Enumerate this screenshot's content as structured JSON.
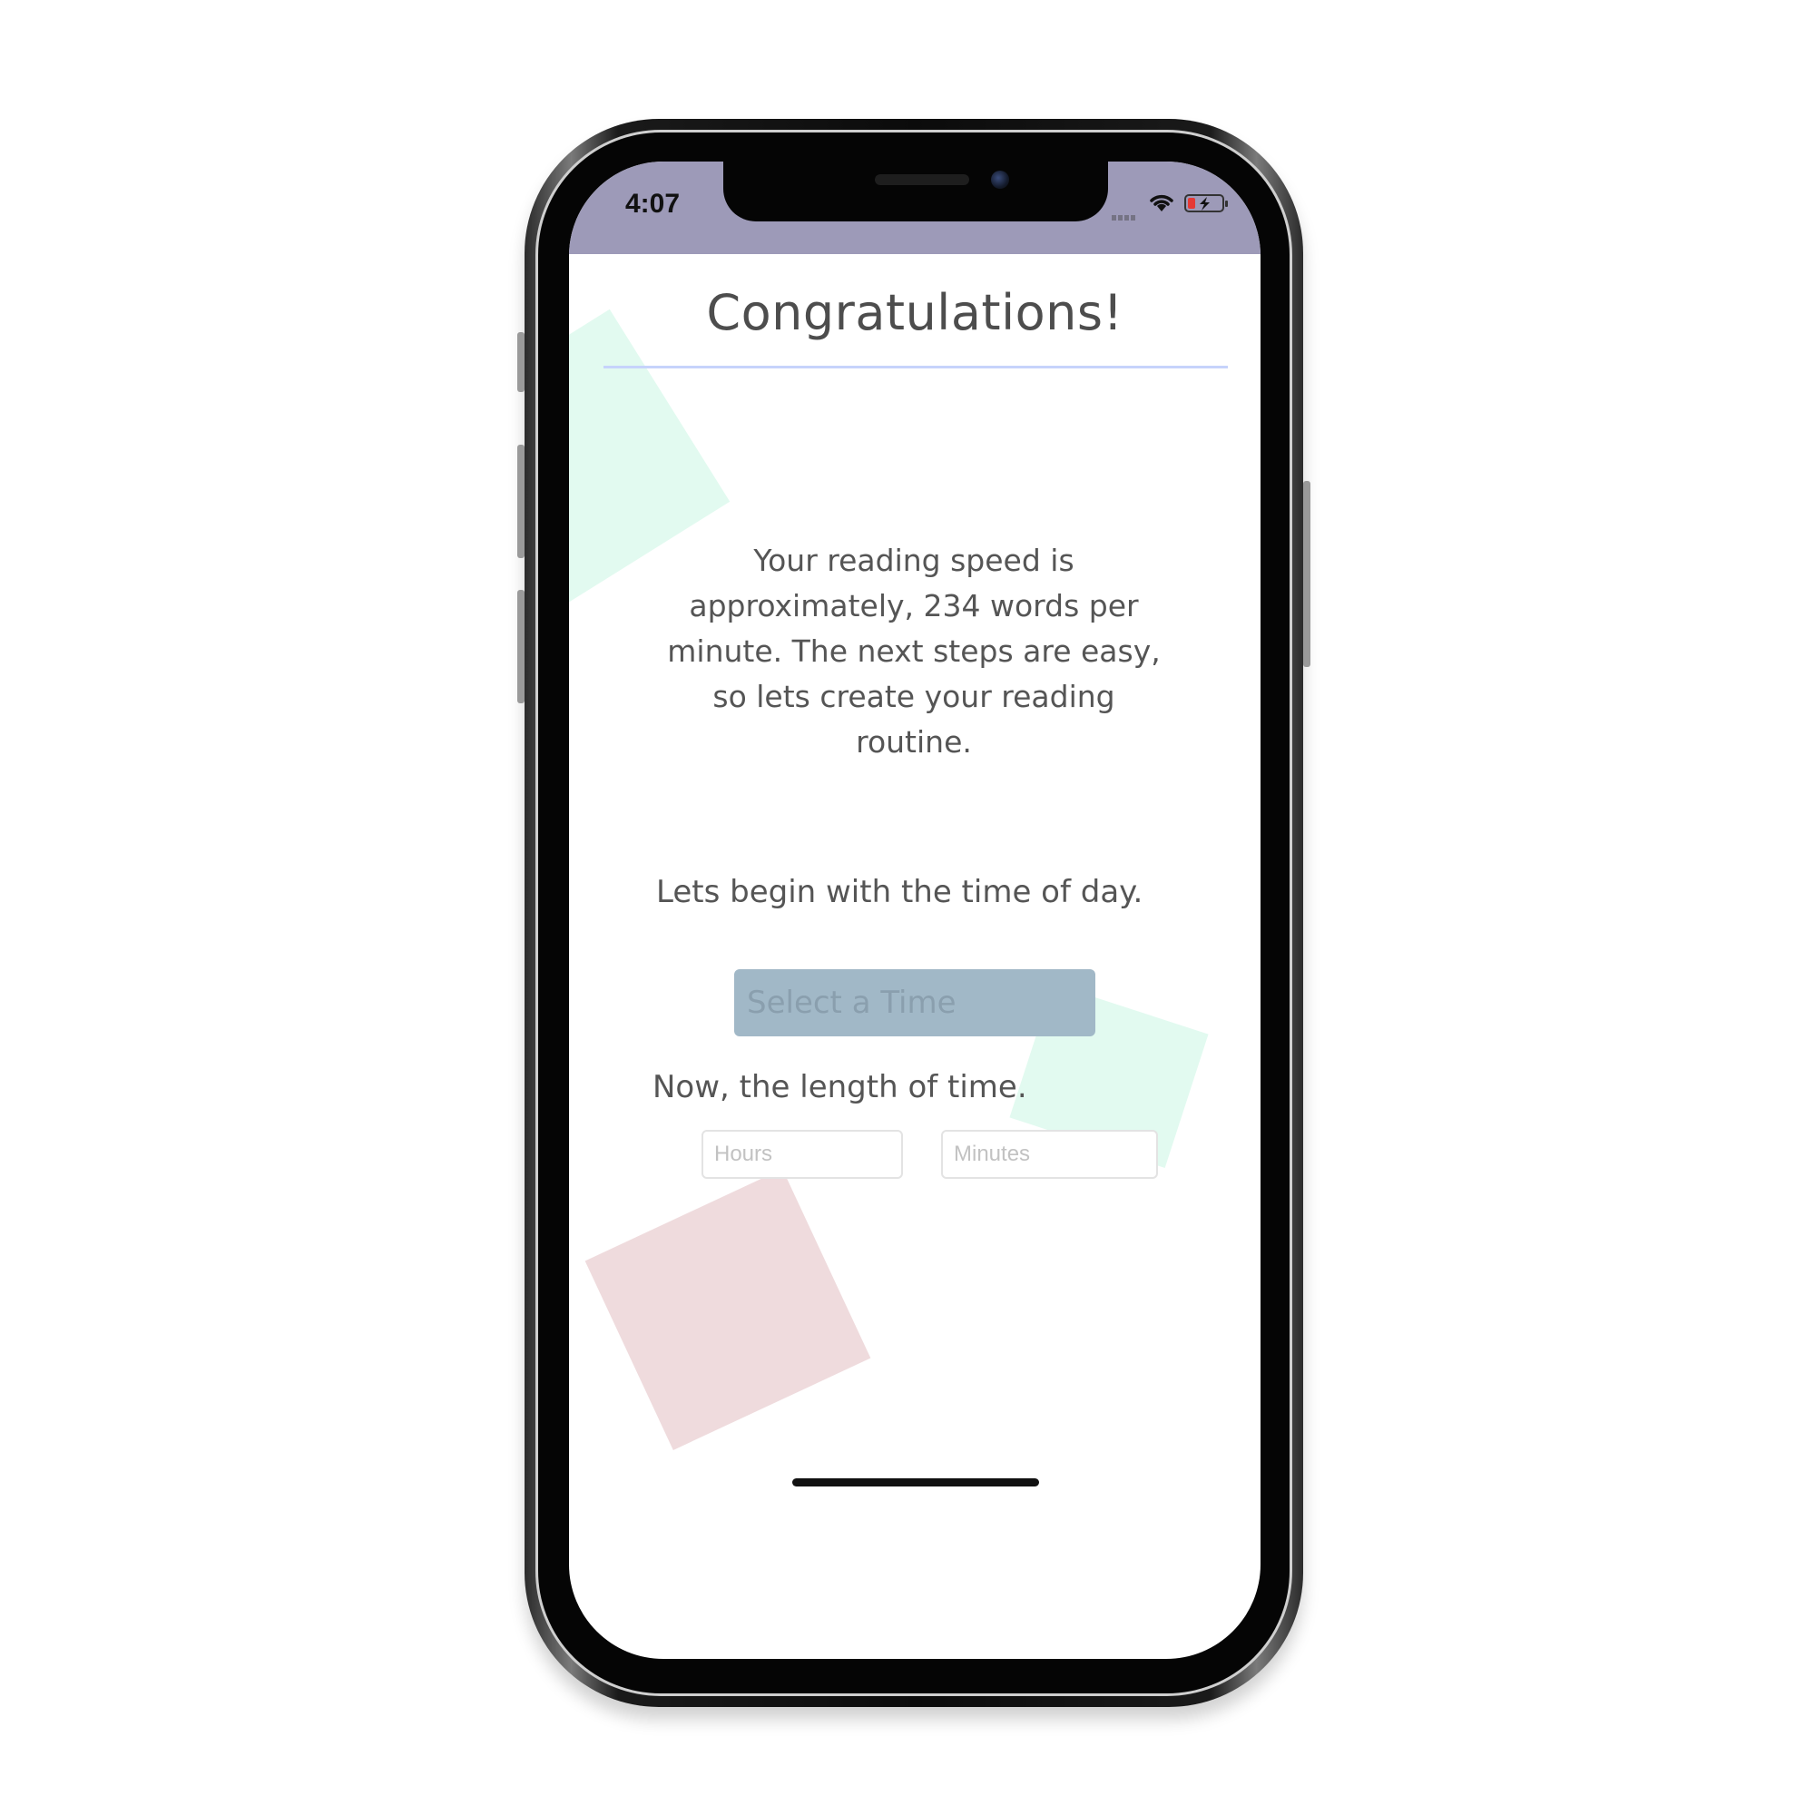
{
  "status_bar": {
    "time": "4:07",
    "background_color": "#9d9ab8",
    "icons": [
      "signal-icon",
      "wifi-icon",
      "battery-icon"
    ]
  },
  "header": {
    "title": "Congratulations!",
    "divider_color": "#c6d3fb"
  },
  "main": {
    "message": "Your reading speed is approximately, 234 words per minute. The next steps are easy, so lets create your reading routine.",
    "time_prompt": "Lets begin with the time of day.",
    "select_time_label": "Select a Time",
    "length_prompt": "Now, the length of time.",
    "hours_placeholder": "Hours",
    "minutes_placeholder": "Minutes"
  },
  "colors": {
    "accent_button": "#a1b8c7",
    "decor_green": "#e2faf0",
    "decor_pink": "#efdbdd",
    "battery_low": "#e53935"
  }
}
